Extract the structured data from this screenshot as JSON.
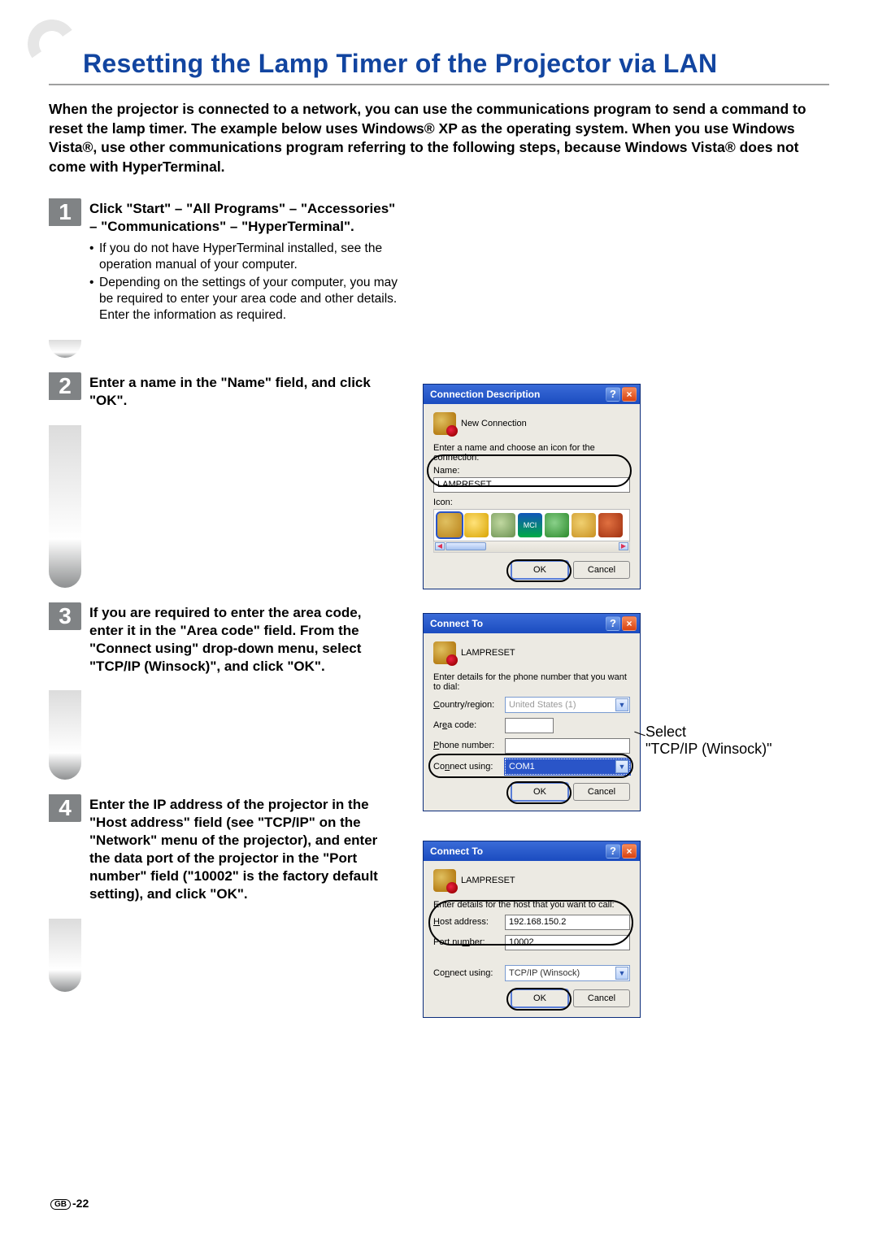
{
  "title": "Resetting the Lamp Timer of the Projector via LAN",
  "intro": "When the projector is connected to a network, you can use the communications program to send a command to reset the lamp timer. The example below uses Windows® XP as the operating system. When you use Windows Vista®, use other communications program referring to the following steps, because Windows Vista® does not come with HyperTerminal.",
  "steps": {
    "s1": {
      "num": "1",
      "title": "Click \"Start\" – \"All Programs\" – \"Accessories\" – \"Communications\" – \"HyperTerminal\".",
      "bullets": [
        "If you do not have HyperTerminal installed, see the operation manual of your computer.",
        "Depending on the settings of your computer, you may be required to enter your area code and other details. Enter the information as required."
      ]
    },
    "s2": {
      "num": "2",
      "title": "Enter a name in the \"Name\" field, and click \"OK\"."
    },
    "s3": {
      "num": "3",
      "title": "If you are required to enter the area code, enter it in the \"Area code\" field. From the \"Connect using\" drop-down menu, select \"TCP/IP (Winsock)\", and click \"OK\"."
    },
    "s4": {
      "num": "4",
      "title": "Enter the IP address of the projector in the \"Host address\" field (see \"TCP/IP\" on the \"Network\" menu of the projector), and enter the data port of the projector  in the \"Port number\" field (\"10002\" is the factory default setting), and click \"OK\"."
    }
  },
  "dialogs": {
    "conndesc": {
      "title": "Connection Description",
      "icon_label": "New Connection",
      "prompt": "Enter a name and choose an icon for the connection:",
      "name_label": "Name:",
      "name_value": "LAMPRESET",
      "icon_label2": "Icon:",
      "ok": "OK",
      "cancel": "Cancel"
    },
    "connect1": {
      "title": "Connect To",
      "icon_label": "LAMPRESET",
      "prompt": "Enter details for the phone number that you want to dial:",
      "country_label": "Country/region:",
      "country_value": "United States (1)",
      "area_label": "Area code:",
      "area_value": "",
      "phone_label": "Phone number:",
      "phone_value": "",
      "connect_label": "Connect using:",
      "connect_value": "COM1",
      "ok": "OK",
      "cancel": "Cancel"
    },
    "connect2": {
      "title": "Connect To",
      "icon_label": "LAMPRESET",
      "prompt": "Enter details for the host that you want to call:",
      "host_label": "Host address:",
      "host_value": "192.168.150.2",
      "port_label": "Port number:",
      "port_value": "10002",
      "connect_label": "Connect using:",
      "connect_value": "TCP/IP (Winsock)",
      "ok": "OK",
      "cancel": "Cancel"
    }
  },
  "annotation": {
    "line1": "Select",
    "line2": "\"TCP/IP (Winsock)\""
  },
  "page": {
    "region": "GB",
    "num": "-22"
  }
}
